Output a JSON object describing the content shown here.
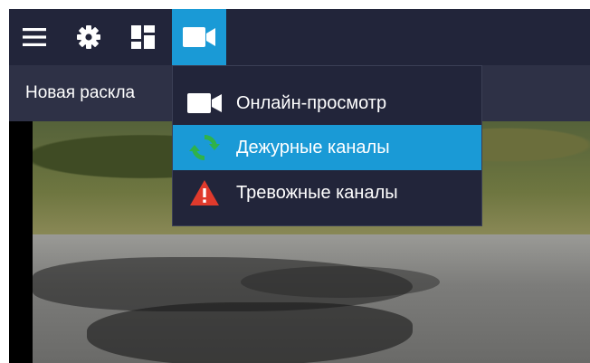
{
  "toolbar": {
    "buttons": [
      {
        "icon": "menu-icon"
      },
      {
        "icon": "gear-icon"
      },
      {
        "icon": "layout-icon"
      },
      {
        "icon": "video-camera-icon",
        "active": true
      }
    ],
    "accent_color": "#1a9ad6"
  },
  "tab": {
    "label": "Новая раскла"
  },
  "dropdown": {
    "items": [
      {
        "label": "Онлайн-просмотр",
        "icon": "video-camera-icon",
        "active": false
      },
      {
        "label": "Дежурные каналы",
        "icon": "refresh-icon",
        "active": true,
        "icon_color": "#2fb24a"
      },
      {
        "label": "Тревожные каналы",
        "icon": "warning-icon",
        "active": false,
        "icon_color": "#e03a2c"
      }
    ]
  }
}
